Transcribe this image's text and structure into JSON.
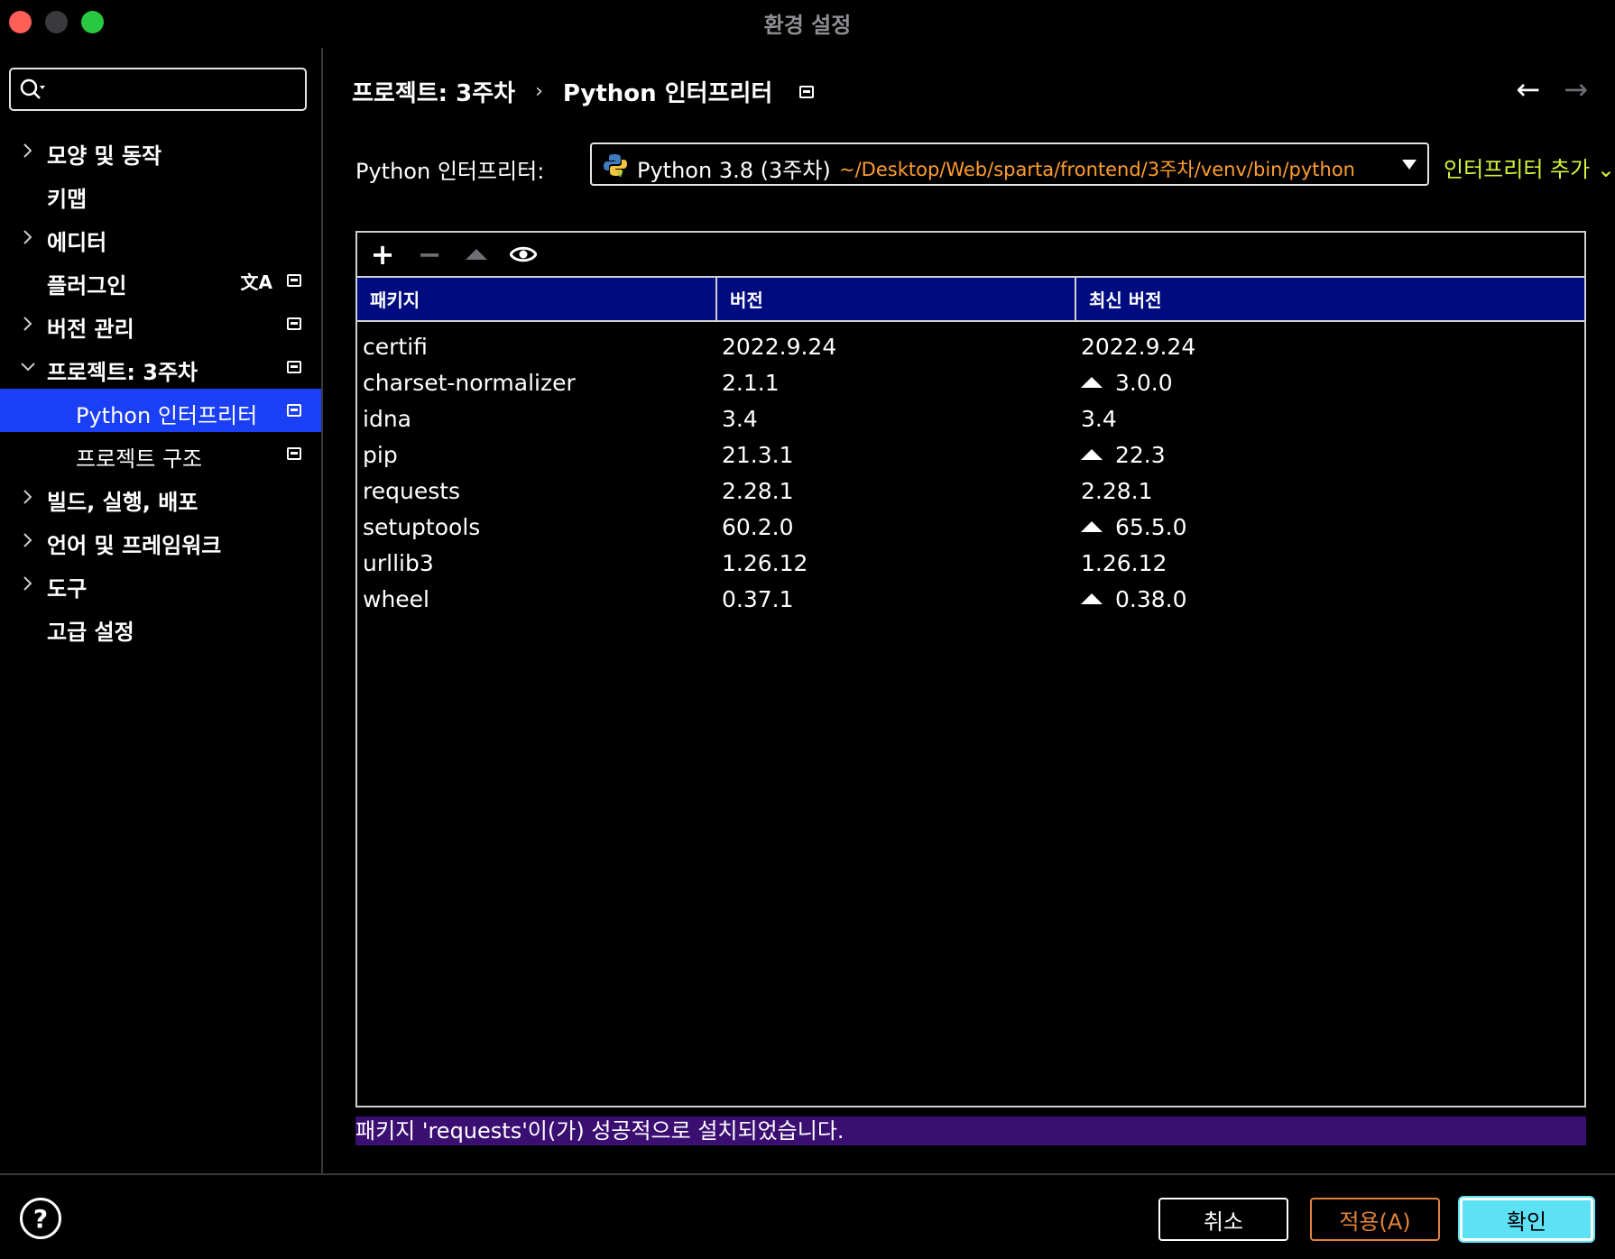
{
  "window": {
    "title": "환경 설정"
  },
  "search": {
    "placeholder": "",
    "value": ""
  },
  "sidebar": {
    "items": [
      {
        "label": "모양 및 동작",
        "expandable": true,
        "expanded": false,
        "pinned": false,
        "sub": false
      },
      {
        "label": "키맵",
        "expandable": false,
        "pinned": false,
        "sub": false
      },
      {
        "label": "에디터",
        "expandable": true,
        "expanded": false,
        "pinned": false,
        "sub": false
      },
      {
        "label": "플러그인",
        "expandable": false,
        "pinned": true,
        "sub": false,
        "lang_icon": "translate-icon"
      },
      {
        "label": "버전 관리",
        "expandable": true,
        "expanded": false,
        "pinned": true,
        "sub": false
      },
      {
        "label": "프로젝트: 3주차",
        "expandable": true,
        "expanded": true,
        "pinned": true,
        "sub": false
      },
      {
        "label": "Python 인터프리터",
        "expandable": false,
        "pinned": true,
        "sub": true,
        "selected": true
      },
      {
        "label": "프로젝트 구조",
        "expandable": false,
        "pinned": true,
        "sub": true
      },
      {
        "label": "빌드, 실행, 배포",
        "expandable": true,
        "expanded": false,
        "pinned": false,
        "sub": false
      },
      {
        "label": "언어 및 프레임워크",
        "expandable": true,
        "expanded": false,
        "pinned": false,
        "sub": false
      },
      {
        "label": "도구",
        "expandable": true,
        "expanded": false,
        "pinned": false,
        "sub": false
      },
      {
        "label": "고급 설정",
        "expandable": false,
        "pinned": false,
        "sub": false
      }
    ]
  },
  "breadcrumb": {
    "project": "프로젝트: 3주차",
    "separator": "›",
    "current": "Python 인터프리터"
  },
  "interpreter": {
    "label": "Python 인터프리터:",
    "name": "Python 3.8 (3주차)",
    "path": "~/Desktop/Web/sparta/frontend/3주차/venv/bin/python",
    "add_label": "인터프리터 추가"
  },
  "packages": {
    "columns": [
      "패키지",
      "버전",
      "최신 버전"
    ],
    "rows": [
      {
        "name": "certifi",
        "version": "2022.9.24",
        "latest": "2022.9.24",
        "upgrade": false
      },
      {
        "name": "charset-normalizer",
        "version": "2.1.1",
        "latest": "3.0.0",
        "upgrade": true
      },
      {
        "name": "idna",
        "version": "3.4",
        "latest": "3.4",
        "upgrade": false
      },
      {
        "name": "pip",
        "version": "21.3.1",
        "latest": "22.3",
        "upgrade": true
      },
      {
        "name": "requests",
        "version": "2.28.1",
        "latest": "2.28.1",
        "upgrade": false
      },
      {
        "name": "setuptools",
        "version": "60.2.0",
        "latest": "65.5.0",
        "upgrade": true
      },
      {
        "name": "urllib3",
        "version": "1.26.12",
        "latest": "1.26.12",
        "upgrade": false
      },
      {
        "name": "wheel",
        "version": "0.37.1",
        "latest": "0.38.0",
        "upgrade": true
      }
    ]
  },
  "status": {
    "message": "패키지 'requests'이(가) 성공적으로 설치되었습니다."
  },
  "footer": {
    "help": "?",
    "cancel": "취소",
    "apply": "적용(A)",
    "ok": "확인"
  },
  "colors": {
    "selection": "#1a3ff5",
    "table_header": "#000b80",
    "status_bg": "#3b0e72",
    "path": "#ff9d2e",
    "add_link": "#d4f53a",
    "ok_button": "#5de1f5"
  }
}
